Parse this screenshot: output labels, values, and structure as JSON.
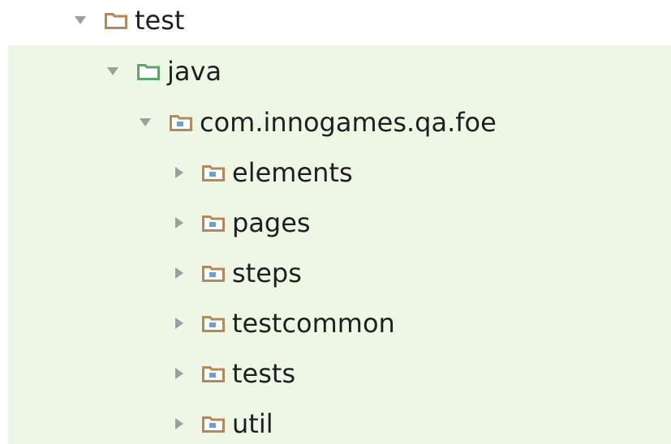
{
  "colors": {
    "test_sources_background": "#eef6e6",
    "plain_folder": "#b4885a",
    "source_root_folder": "#59a869",
    "package_folder": "#b4885a",
    "package_dot": "#6f9fcf",
    "arrow": "#9e9e9e",
    "text": "#1f1f1f"
  },
  "tree": {
    "test": {
      "label": "test",
      "expanded": true,
      "icon": "folder-icon"
    },
    "java": {
      "label": "java",
      "expanded": true,
      "icon": "source-root-folder-icon"
    },
    "package_root": {
      "label": "com.innogames.qa.foe",
      "expanded": true,
      "icon": "package-icon"
    },
    "children": [
      {
        "label": "elements",
        "expanded": false,
        "icon": "package-icon"
      },
      {
        "label": "pages",
        "expanded": false,
        "icon": "package-icon"
      },
      {
        "label": "steps",
        "expanded": false,
        "icon": "package-icon"
      },
      {
        "label": "testcommon",
        "expanded": false,
        "icon": "package-icon"
      },
      {
        "label": "tests",
        "expanded": false,
        "icon": "package-icon"
      },
      {
        "label": "util",
        "expanded": false,
        "icon": "package-icon"
      }
    ]
  }
}
